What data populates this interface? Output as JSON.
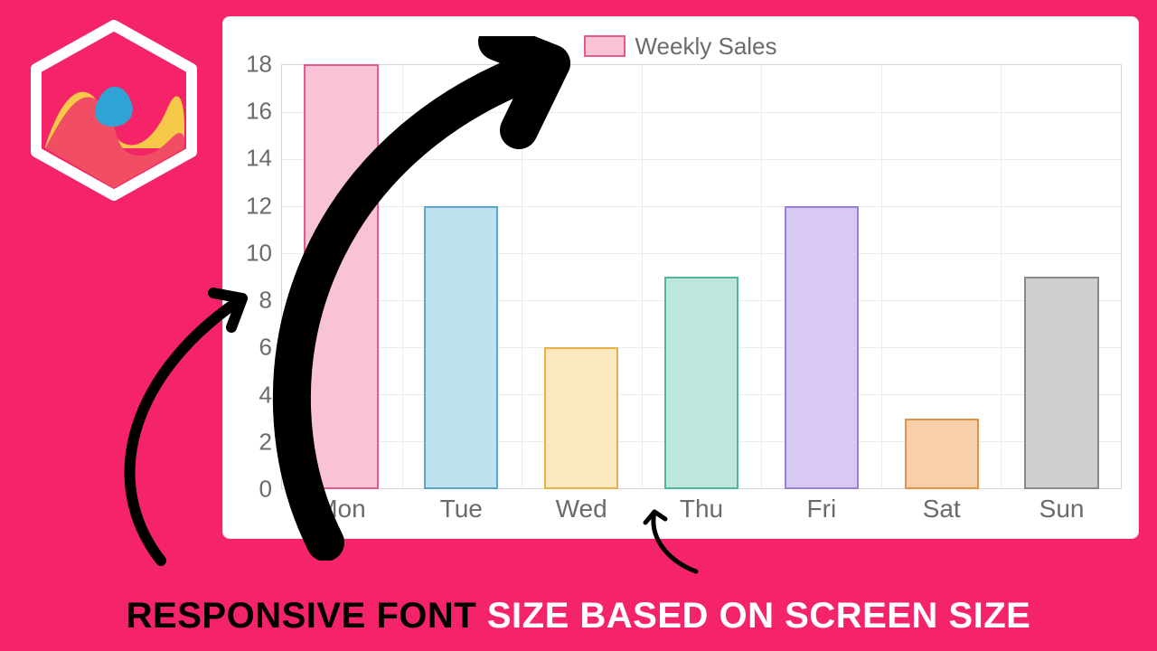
{
  "legend_label": "Weekly Sales",
  "caption_part1": "RESPONSIVE FONT ",
  "caption_part2": "SIZE BASED ON SCREEN SIZE",
  "chart_data": {
    "type": "bar",
    "title": "",
    "legend": [
      "Weekly Sales"
    ],
    "legend_position": "top",
    "xlabel": "",
    "ylabel": "",
    "ylim": [
      0,
      18
    ],
    "yticks": [
      0,
      2,
      4,
      6,
      8,
      10,
      12,
      14,
      16,
      18
    ],
    "categories": [
      "Mon",
      "Tue",
      "Wed",
      "Thu",
      "Fri",
      "Sat",
      "Sun"
    ],
    "values": [
      18,
      12,
      6,
      9,
      12,
      3,
      9
    ],
    "grid": true,
    "colors": {
      "fill": [
        "#f9c2d6",
        "#bfe0ef",
        "#fbe8bf",
        "#bfe6dd",
        "#d7c9f2",
        "#f7cfa8",
        "#cfcfcf"
      ],
      "stroke": [
        "#e75a8d",
        "#5aa7c9",
        "#e4b24a",
        "#4fb59c",
        "#9a7fd6",
        "#e29248",
        "#8a8a8a"
      ]
    }
  }
}
